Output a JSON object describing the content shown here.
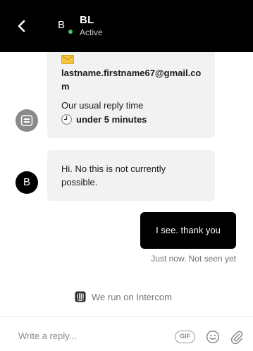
{
  "header": {
    "avatar_letter": "B",
    "name": "BL",
    "status": "Active"
  },
  "messages": {
    "card": {
      "email": "lastname.firstname67@gmail.com",
      "reply_time_label": "Our usual reply time",
      "reply_time_value": "under 5 minutes"
    },
    "agent_message": "Hi. No this is not currently possible.",
    "agent_avatar_letter": "B",
    "user_message": "I see. thank you",
    "user_meta": "Just now. Not seen yet"
  },
  "footer": {
    "powered_by": "We run on Intercom"
  },
  "composer": {
    "placeholder": "Write a reply...",
    "gif_label": "GIF"
  },
  "colors": {
    "header_bg": "#000000",
    "online_dot": "#45c36a",
    "incoming_bubble": "#f2f2f2",
    "outgoing_bubble": "#000000"
  }
}
